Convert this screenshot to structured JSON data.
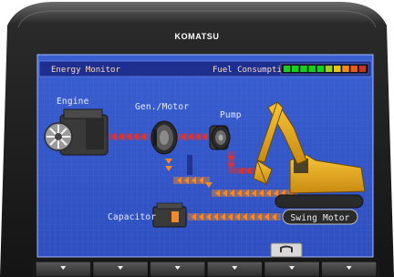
{
  "bezel": {
    "brand": "KOMATSU"
  },
  "header": {
    "title": "Energy Monitor",
    "fuel_label": "Fuel Consumption",
    "fuel_gauge": {
      "segments": [
        "#17d01a",
        "#17d01a",
        "#17d01a",
        "#17d01a",
        "#17d01a",
        "#9fd117",
        "#e6c81b",
        "#f08a1a",
        "#ea5a1a",
        "#c23a22"
      ]
    }
  },
  "diagram": {
    "engine_label": "Engine",
    "gen_motor_label": "Gen./Motor",
    "pump_label": "Pump",
    "capacitor_label": "Capacitor",
    "swing_motor_label": "Swing Motor"
  },
  "softkeys": [
    {
      "name": "f1",
      "icon": "triangle-down"
    },
    {
      "name": "f2",
      "icon": "triangle-down"
    },
    {
      "name": "f3",
      "icon": "triangle-down"
    },
    {
      "name": "f4",
      "icon": "triangle-down"
    },
    {
      "name": "f5",
      "icon": "triangle-down"
    },
    {
      "name": "f6",
      "icon": "triangle-down"
    }
  ],
  "colors": {
    "screen_bg": "#3558c8",
    "header_bg": "#1d2f8f",
    "flow_red": "#e0332e",
    "flow_orange": "#f08a2c",
    "excavator_yellow": "#f0b21f"
  }
}
